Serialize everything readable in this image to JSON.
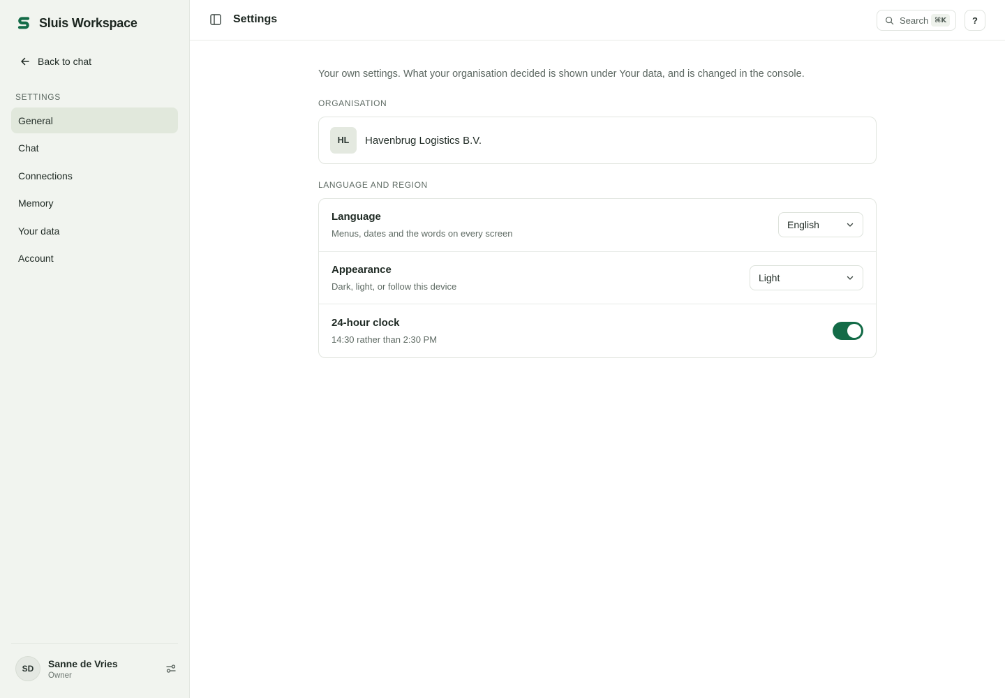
{
  "app": {
    "name": "Sluis Workspace"
  },
  "sidebar": {
    "back_label": "Back to chat",
    "section_label": "SETTINGS",
    "items": [
      {
        "label": "General",
        "active": true
      },
      {
        "label": "Chat"
      },
      {
        "label": "Connections"
      },
      {
        "label": "Memory"
      },
      {
        "label": "Your data"
      },
      {
        "label": "Account"
      }
    ],
    "user": {
      "initials": "SD",
      "name": "Sanne de Vries",
      "role": "Owner"
    }
  },
  "header": {
    "title": "Settings",
    "search_label": "Search",
    "search_shortcut": "⌘K",
    "help_label": "?"
  },
  "main": {
    "intro": "Your own settings. What your organisation decided is shown under Your data, and is changed in the console.",
    "organisation": {
      "label": "ORGANISATION",
      "initials": "HL",
      "name": "Havenbrug Logistics B.V."
    },
    "language_region": {
      "label": "LANGUAGE AND REGION",
      "language": {
        "title": "Language",
        "desc": "Menus, dates and the words on every screen",
        "value": "English"
      },
      "appearance": {
        "title": "Appearance",
        "desc": "Dark, light, or follow this device",
        "value": "Light"
      },
      "clock": {
        "title": "24-hour clock",
        "desc": "14:30 rather than 2:30 PM",
        "enabled": true
      }
    }
  },
  "colors": {
    "accent": "#136b47",
    "sidebar_bg": "#f1f4ef",
    "active_item_bg": "#e1e8dc"
  }
}
